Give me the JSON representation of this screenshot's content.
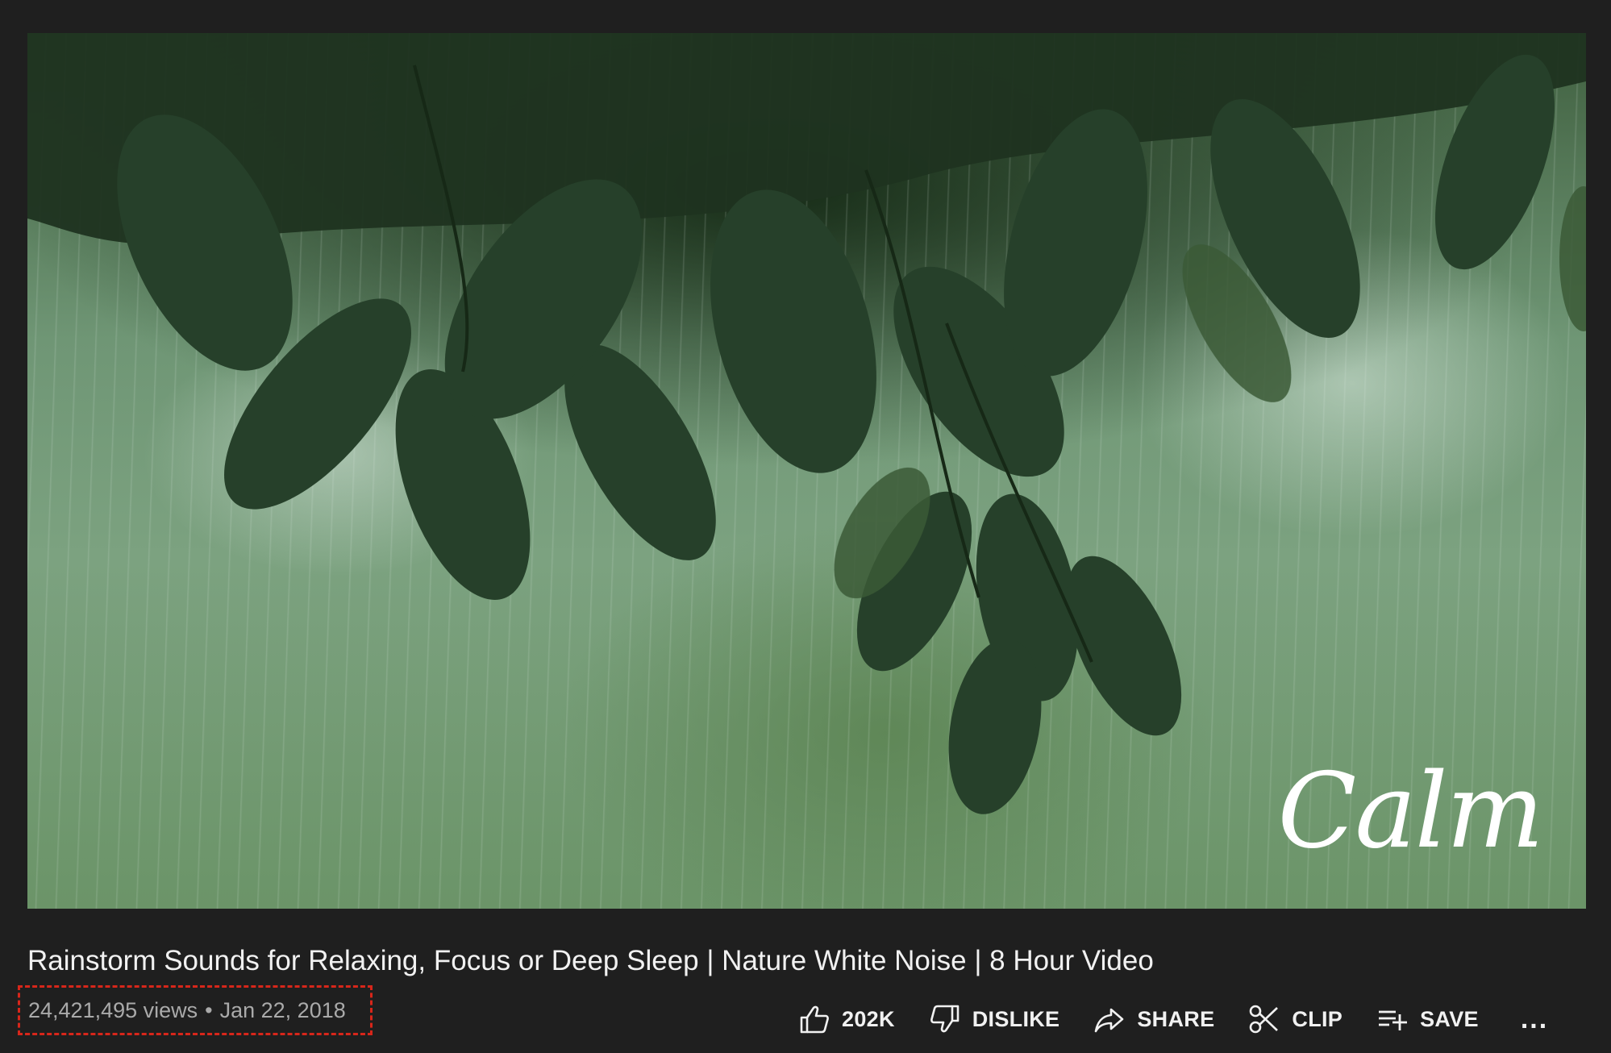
{
  "video": {
    "logo": "Calm",
    "title": "Rainstorm Sounds for Relaxing, Focus or Deep Sleep | Nature White Noise | 8 Hour Video",
    "views": "24,421,495 views",
    "separator": "•",
    "date": "Jan 22, 2018"
  },
  "actions": {
    "like_count": "202K",
    "dislike_label": "DISLIKE",
    "share_label": "SHARE",
    "clip_label": "CLIP",
    "save_label": "SAVE",
    "more_label": "..."
  },
  "icons": {
    "like": "thumbs-up-icon",
    "dislike": "thumbs-down-icon",
    "share": "share-arrow-icon",
    "clip": "scissors-icon",
    "save": "playlist-add-icon",
    "more": "more-horizontal-icon"
  },
  "colors": {
    "page_background": "#1f1f1f",
    "highlight_box": "#d7261a",
    "meta_text": "#aaaaaa"
  }
}
